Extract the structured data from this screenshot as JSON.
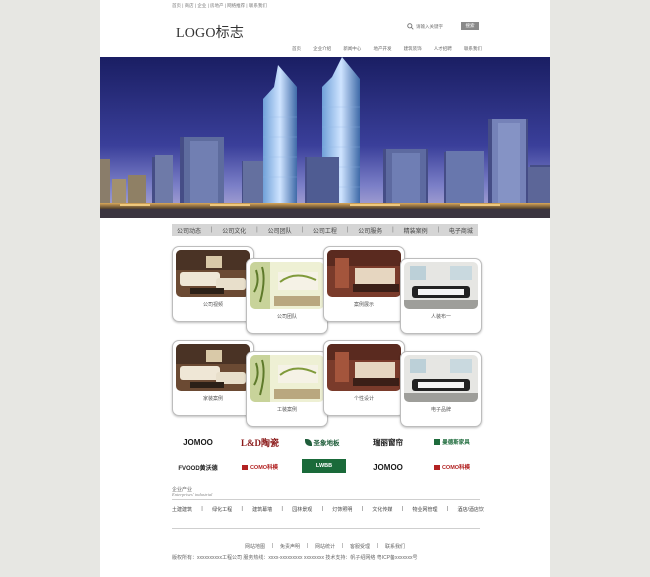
{
  "header": {
    "top_links": "首页 | 商店 | 企业 | 房地产 | 网络推荐 | 联系我们",
    "logo": "LOGO标志",
    "search_placeholder": "请输入关键字",
    "search_button": "搜索",
    "nav": [
      "首页",
      "企业介绍",
      "新闻中心",
      "地产开发",
      "建筑装饰",
      "人才招聘",
      "联系我们"
    ]
  },
  "subnav": [
    "公司动态",
    "公司文化",
    "公司团队",
    "公司工程",
    "公司服务",
    "精装案例",
    "电子商城"
  ],
  "cards_row1": [
    {
      "label": "公司视频",
      "icon": "living-room-photo"
    },
    {
      "label": "公司团队",
      "icon": "wall-art-room-photo"
    },
    {
      "label": "案例展示",
      "icon": "bedroom-photo"
    },
    {
      "label": "人装布一",
      "icon": "lounge-photo"
    }
  ],
  "cards_row2": [
    {
      "label": "家装案例",
      "icon": "living-room-photo"
    },
    {
      "label": "工装案例",
      "icon": "wall-art-room-photo"
    },
    {
      "label": "个性设计",
      "icon": "bedroom-photo"
    },
    {
      "label": "电子品牌",
      "icon": "lounge-photo"
    }
  ],
  "brands": [
    {
      "name": "JOMOO",
      "color": "#1a1a1a"
    },
    {
      "name": "L&D陶瓷",
      "color": "#8b1a1a"
    },
    {
      "name": "圣象地板",
      "color": "#1f5d3a"
    },
    {
      "name": "瑞丽窗帘",
      "color": "#1a1a1a"
    },
    {
      "name": "曼德斯家具",
      "color": "#1e6b3c"
    },
    {
      "name": "FVOOD黄沃德",
      "color": "#222222"
    },
    {
      "name": "COMO科模",
      "color": "#b22222"
    },
    {
      "name": "LWBB",
      "color": "#1a6a3a"
    },
    {
      "name": "JOMOO",
      "color": "#1a1a1a"
    },
    {
      "name": "COMO科模",
      "color": "#b22222"
    }
  ],
  "industries": {
    "title": "企业产业",
    "subtitle": "Enterprises' industrial",
    "items": [
      "土建建筑",
      "绿化工程",
      "建筑幕墙",
      "园林景观",
      "灯饰照明",
      "文化传媒",
      "物业网管理",
      "酒店/酒店饮"
    ]
  },
  "footer": {
    "links": [
      "网站地图",
      "免责声明",
      "网站统计",
      "客服受理",
      "联系我们"
    ],
    "copyright": "版权所有：xxxxxxxxxx工程公司  服务热线：xxxx-xxxxxxxxx xxxxxxxx  技术支持：帆子绍网络  粤ICP备xxxxxxx号"
  },
  "colors": {
    "page_bg": "#e7e7e3",
    "content_bg": "#ffffff",
    "subnav_bg": "#d5d5d5",
    "search_button": "#8a8a8a"
  }
}
